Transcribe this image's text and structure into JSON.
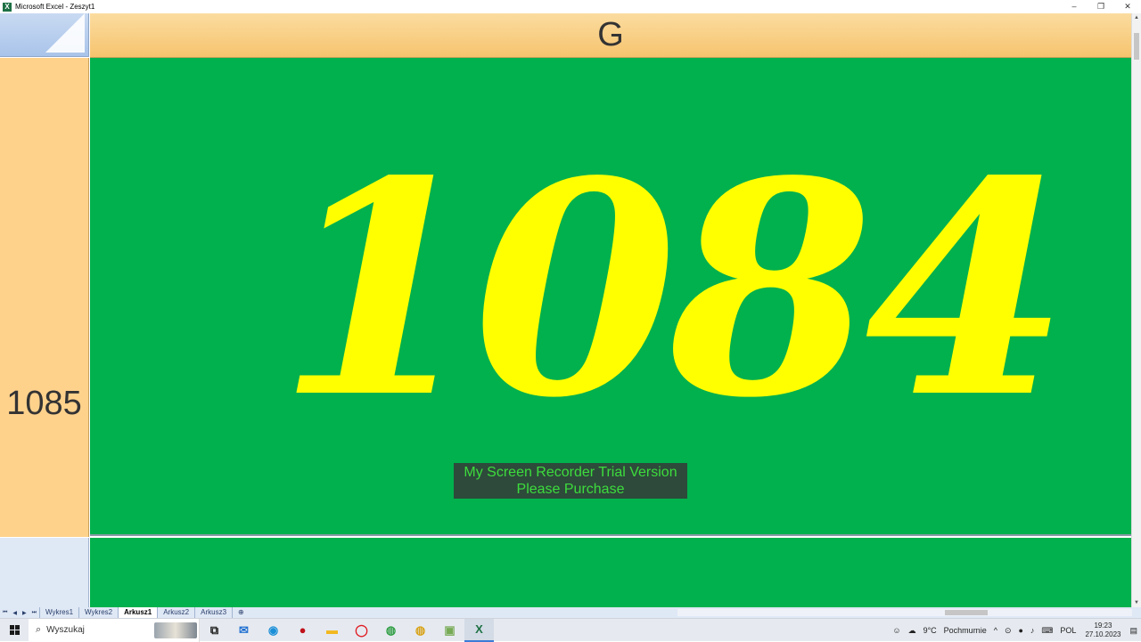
{
  "window": {
    "title": "Microsoft Excel - Zeszyt1",
    "app_icon": "X"
  },
  "window_controls": {
    "minimize": "–",
    "restore": "❐",
    "close": "✕"
  },
  "sheet": {
    "column_header": "G",
    "row_header": "1085",
    "cell_value": "1084",
    "cell_bg_color": "#00b14d",
    "cell_text_color": "#ffff00"
  },
  "watermark": {
    "line1": "My Screen Recorder Trial Version",
    "line2": "Please Purchase"
  },
  "sheet_tabs": {
    "nav": [
      "⏮",
      "◀",
      "▶",
      "⏭"
    ],
    "tabs": [
      {
        "label": "Wykres1",
        "active": false
      },
      {
        "label": "Wykres2",
        "active": false
      },
      {
        "label": "Arkusz1",
        "active": true
      },
      {
        "label": "Arkusz2",
        "active": false
      },
      {
        "label": "Arkusz3",
        "active": false
      }
    ]
  },
  "taskbar": {
    "search_placeholder": "Wyszukaj",
    "icons": [
      {
        "name": "task-view-icon",
        "glyph": "⧉",
        "color": "#222222"
      },
      {
        "name": "mail-icon",
        "glyph": "✉",
        "color": "#1f6fd1"
      },
      {
        "name": "edge-icon",
        "glyph": "◉",
        "color": "#1a8fd8"
      },
      {
        "name": "app-red-icon",
        "glyph": "●",
        "color": "#c0121b"
      },
      {
        "name": "file-explorer-icon",
        "glyph": "▬",
        "color": "#f2b81e"
      },
      {
        "name": "opera-icon",
        "glyph": "◯",
        "color": "#e01a22"
      },
      {
        "name": "chrome-icon",
        "glyph": "◍",
        "color": "#2f9e44"
      },
      {
        "name": "chrome-profile-icon",
        "glyph": "◍",
        "color": "#d8a31a"
      },
      {
        "name": "snip-icon",
        "glyph": "▣",
        "color": "#7a5"
      },
      {
        "name": "excel-icon",
        "glyph": "X",
        "color": "#1e7145"
      }
    ],
    "tray": {
      "weather_temp": "9°C",
      "weather_text": "Pochmurnie",
      "language": "POL",
      "time": "19:23",
      "date": "27.10.2023"
    }
  }
}
